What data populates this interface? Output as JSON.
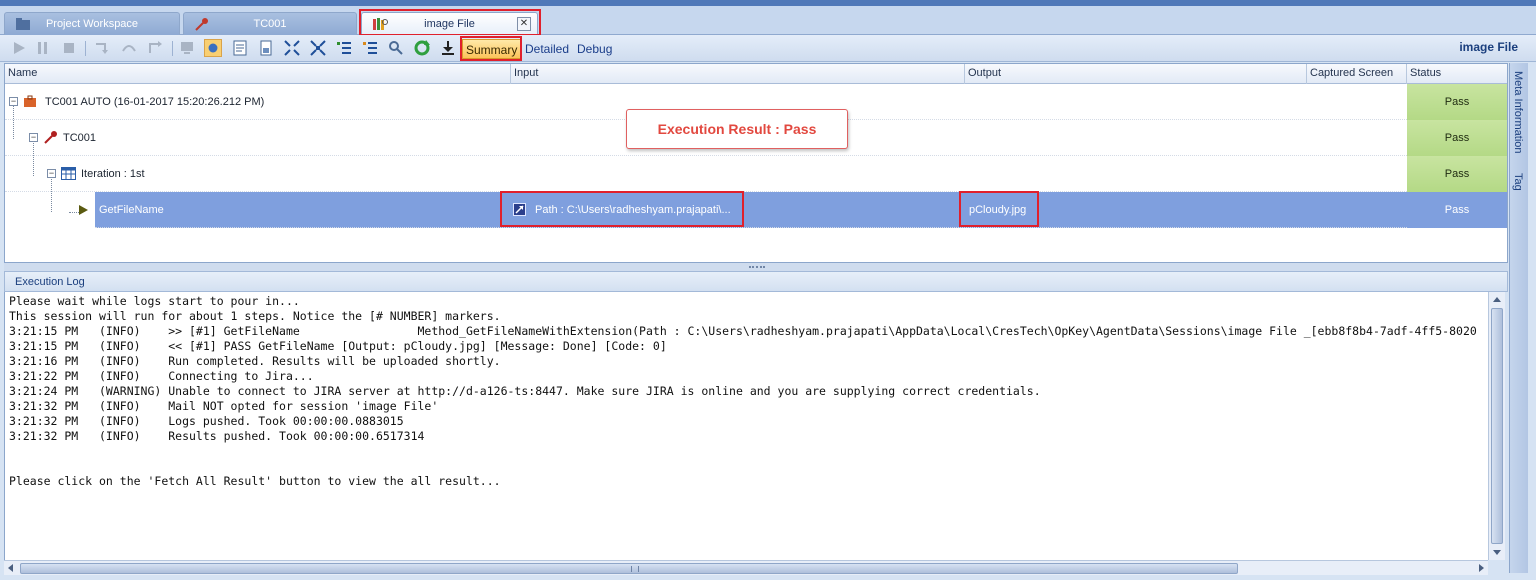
{
  "tabs": [
    {
      "label": "Project Workspace",
      "icon": "folder-icon"
    },
    {
      "label": "TC001",
      "icon": "key-icon"
    },
    {
      "label": "image File",
      "icon": "books-icon",
      "close": "✕"
    }
  ],
  "toolbar": {
    "summary": "Summary",
    "detailed": "Detailed",
    "debug": "Debug",
    "panel_title": "image File"
  },
  "grid": {
    "columns": [
      "Name",
      "Input",
      "Output",
      "Captured Screen",
      "Status"
    ],
    "rows": [
      {
        "name": "TC001 AUTO (16-01-2017 15:20:26.212 PM)",
        "input": "",
        "output": "",
        "status": "Pass"
      },
      {
        "name": "TC001",
        "input": "",
        "output": "",
        "status": "Pass"
      },
      {
        "name": "Iteration : 1st",
        "input": "",
        "output": "",
        "status": "Pass"
      },
      {
        "name": "GetFileName",
        "input": "Path : C:\\Users\\radheshyam.prajapati\\...",
        "output": "pCloudy.jpg",
        "status": "Pass"
      }
    ]
  },
  "annotation": "Execution Result : Pass",
  "side_tabs": [
    "Meta Information",
    "Tag"
  ],
  "log": {
    "title": "Execution Log",
    "lines": [
      "Please wait while logs start to pour in...",
      "This session will run for about 1 steps. Notice the [# NUMBER] markers.",
      "3:21:15 PM   (INFO)    >> [#1] GetFileName                 Method_GetFileNameWithExtension(Path : C:\\Users\\radheshyam.prajapati\\AppData\\Local\\CresTech\\OpKey\\AgentData\\Sessions\\image File _[ebb8f8b4-7adf-4ff5-8020",
      "3:21:15 PM   (INFO)    << [#1] PASS GetFileName [Output: pCloudy.jpg] [Message: Done] [Code: 0]",
      "3:21:16 PM   (INFO)    Run completed. Results will be uploaded shortly.",
      "3:21:22 PM   (INFO)    Connecting to Jira...",
      "3:21:24 PM   (WARNING) Unable to connect to JIRA server at http://d-a126-ts:8447. Make sure JIRA is online and you are supplying correct credentials.",
      "3:21:32 PM   (INFO)    Mail NOT opted for session 'image File'",
      "3:21:32 PM   (INFO)    Logs pushed. Took 00:00:00.0883015",
      "3:21:32 PM   (INFO)    Results pushed. Took 00:00:00.6517314",
      "",
      "",
      "Please click on the 'Fetch All Result' button to view the all result..."
    ]
  },
  "colors": {
    "highlight": "#e0202c",
    "selected_row": "#7f9fde",
    "pass_cell": "#c8e4a0"
  }
}
